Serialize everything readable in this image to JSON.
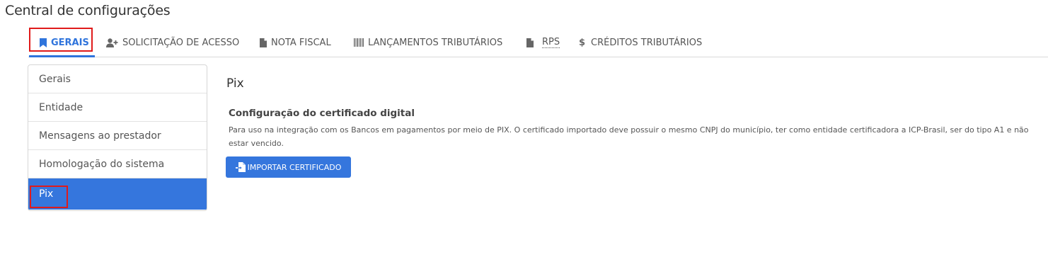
{
  "page_title": "Central de configurações",
  "tabs": [
    {
      "label": "GERAIS",
      "icon": "bookmark-icon",
      "active": true
    },
    {
      "label": "SOLICITAÇÃO DE ACESSO",
      "icon": "user-plus-icon",
      "active": false
    },
    {
      "label": "NOTA FISCAL",
      "icon": "file-icon",
      "active": false
    },
    {
      "label": "LANÇAMENTOS TRIBUTÁRIOS",
      "icon": "barcode-icon",
      "active": false
    },
    {
      "label": "RPS",
      "icon": "file-icon",
      "active": false
    },
    {
      "label": "CRÉDITOS TRIBUTÁRIOS",
      "icon": "dollar-icon",
      "active": false
    }
  ],
  "side_menu": {
    "items": [
      {
        "label": "Gerais",
        "active": false
      },
      {
        "label": "Entidade",
        "active": false
      },
      {
        "label": "Mensagens ao prestador",
        "active": false
      },
      {
        "label": "Homologação do sistema",
        "active": false
      },
      {
        "label": "Pix",
        "active": true
      }
    ]
  },
  "content": {
    "section_title": "Pix",
    "cert_title": "Configuração do certificado digital",
    "cert_description": "Para uso na integração com os Bancos em pagamentos por meio de PIX. O certificado importado deve possuir o mesmo CNPJ do município, ter como entidade certificadora a ICP-Brasil, ser do tipo A1 e não estar vencido.",
    "import_button_label": "IMPORTAR CERTIFICADO",
    "import_button_icon": "file-import-icon"
  },
  "colors": {
    "accent": "#3576dd",
    "highlight_border": "#e01b1b",
    "text": "#333333"
  }
}
